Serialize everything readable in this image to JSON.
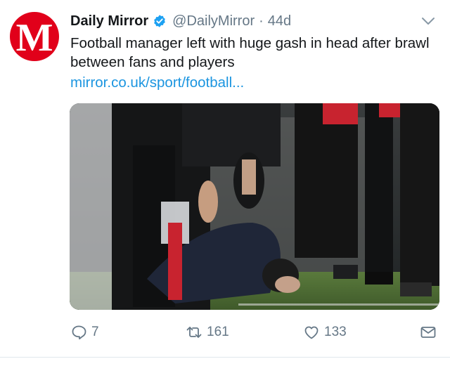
{
  "tweet": {
    "author_name": "Daily Mirror",
    "handle": "@DailyMirror",
    "separator": "·",
    "time": "44d",
    "text": "Football manager left with huge gash in head after brawl between fans and players",
    "link": "mirror.co.uk/sport/football...",
    "avatar_letter": "M"
  },
  "actions": {
    "replies": "7",
    "retweets": "161",
    "likes": "133"
  },
  "colors": {
    "brand_red": "#e1001a",
    "link_blue": "#1b95e0",
    "verified_blue": "#1da1f2",
    "muted": "#657786"
  }
}
